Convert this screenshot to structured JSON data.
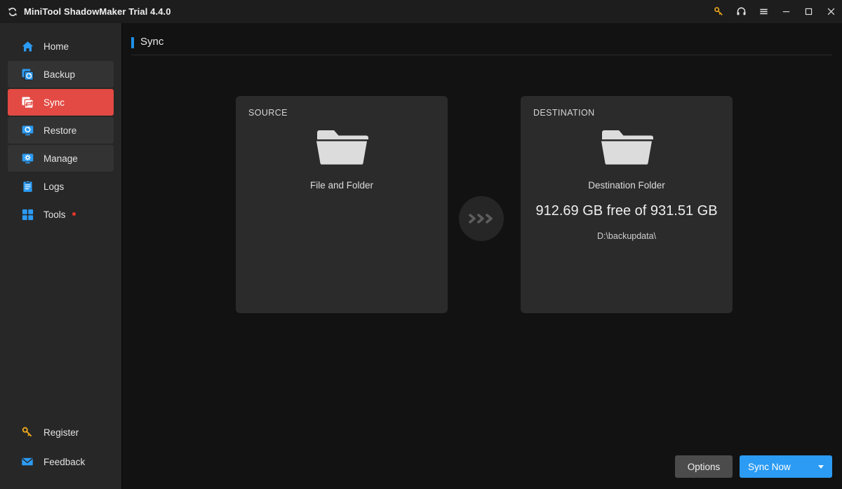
{
  "window": {
    "title": "MiniTool ShadowMaker Trial 4.4.0",
    "logo_icon": "sync-logo-icon",
    "controls": [
      {
        "name": "key-icon",
        "label": "Register",
        "color": "#f0a81e"
      },
      {
        "name": "headset-icon",
        "label": "Support",
        "color": "#e6e6e6"
      },
      {
        "name": "hamburger-icon",
        "label": "Menu",
        "color": "#e6e6e6"
      },
      {
        "name": "minimize-icon",
        "label": "Minimize",
        "color": "#e6e6e6"
      },
      {
        "name": "maximize-icon",
        "label": "Maximize",
        "color": "#e6e6e6"
      },
      {
        "name": "close-icon",
        "label": "Close",
        "color": "#e6e6e6"
      }
    ]
  },
  "sidebar": {
    "items": [
      {
        "label": "Home",
        "icon": "home-icon",
        "style": "plain",
        "badge": false
      },
      {
        "label": "Backup",
        "icon": "backup-icon",
        "style": "raised",
        "badge": false
      },
      {
        "label": "Sync",
        "icon": "sync-icon",
        "style": "active",
        "badge": false
      },
      {
        "label": "Restore",
        "icon": "restore-icon",
        "style": "raised",
        "badge": false
      },
      {
        "label": "Manage",
        "icon": "manage-icon",
        "style": "raised",
        "badge": false
      },
      {
        "label": "Logs",
        "icon": "logs-icon",
        "style": "plain",
        "badge": false
      },
      {
        "label": "Tools",
        "icon": "tools-icon",
        "style": "plain",
        "badge": true
      }
    ],
    "bottom_items": [
      {
        "label": "Register",
        "icon": "key-icon"
      },
      {
        "label": "Feedback",
        "icon": "envelope-icon"
      }
    ]
  },
  "page": {
    "title": "Sync",
    "accent_color": "#1e90e8"
  },
  "source_card": {
    "kicker": "SOURCE",
    "icon": "folder-icon",
    "label": "File and Folder"
  },
  "destination_card": {
    "kicker": "DESTINATION",
    "icon": "folder-icon",
    "label": "Destination Folder",
    "capacity": "912.69 GB free of 931.51 GB",
    "path": "D:\\backupdata\\"
  },
  "transfer": {
    "icon": "chevrons-right-icon"
  },
  "footer": {
    "options_label": "Options",
    "sync_now_label": "Sync Now",
    "dropdown_icon": "chevron-down-icon",
    "primary_color": "#2b9bf4"
  }
}
